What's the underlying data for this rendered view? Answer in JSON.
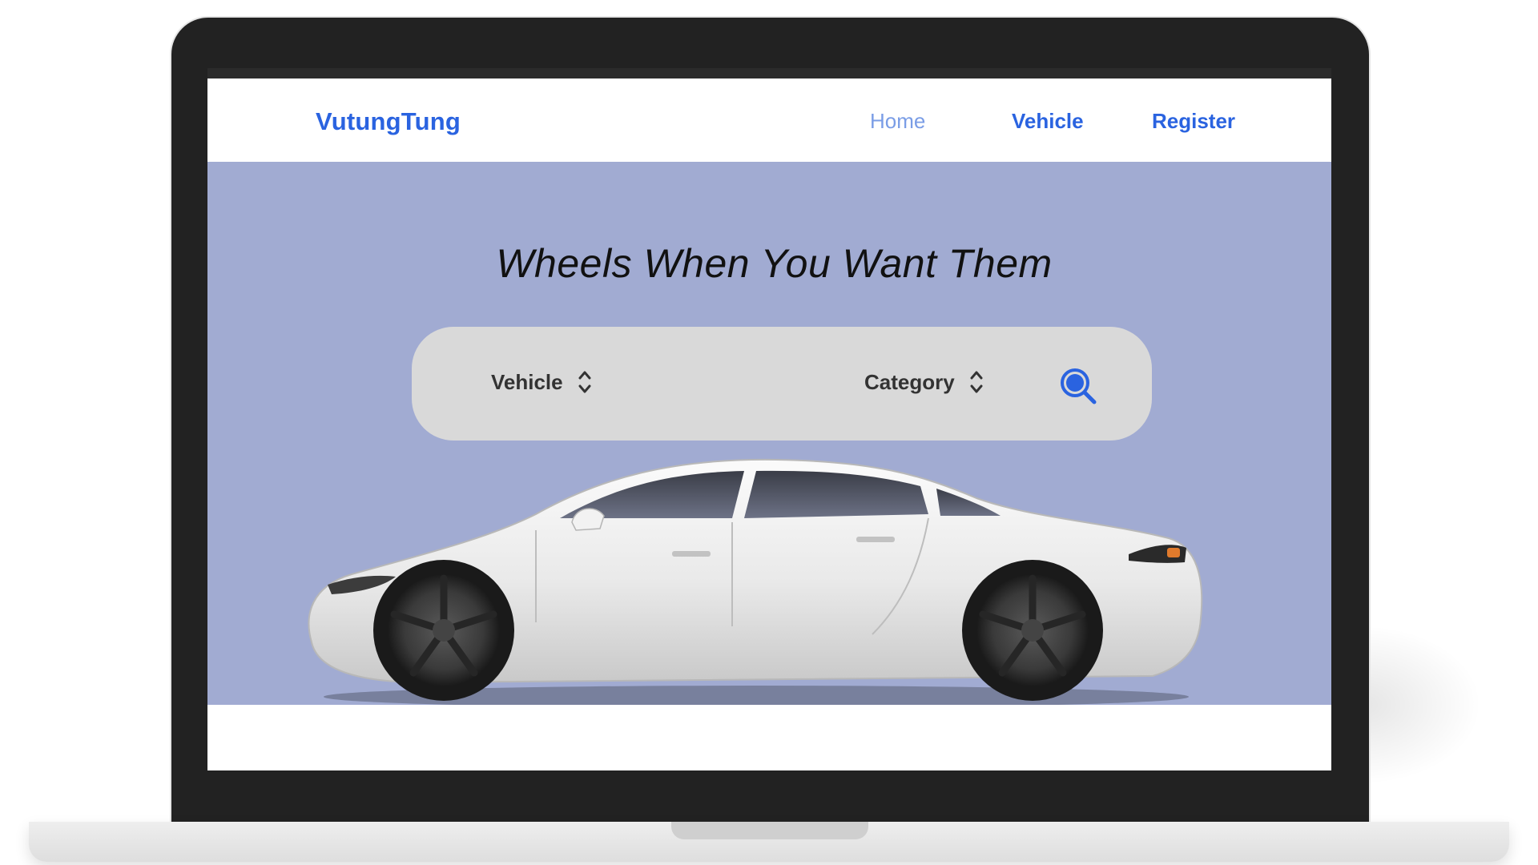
{
  "brand": {
    "name": "VutungTung"
  },
  "nav": {
    "items": [
      {
        "label": "Home"
      },
      {
        "label": "Vehicle"
      },
      {
        "label": "Register"
      }
    ]
  },
  "hero": {
    "headline": "Wheels When You Want Them",
    "background_color": "#a1abd2"
  },
  "search": {
    "vehicle_select": {
      "label": "Vehicle",
      "icon": "chevron-up-down-icon"
    },
    "category_select": {
      "label": "Category",
      "icon": "chevron-up-down-icon"
    },
    "search_button": {
      "icon": "search-icon"
    }
  },
  "colors": {
    "accent": "#2a63e0",
    "search_bar": "#d9d9d9",
    "bezel": "#222222"
  }
}
